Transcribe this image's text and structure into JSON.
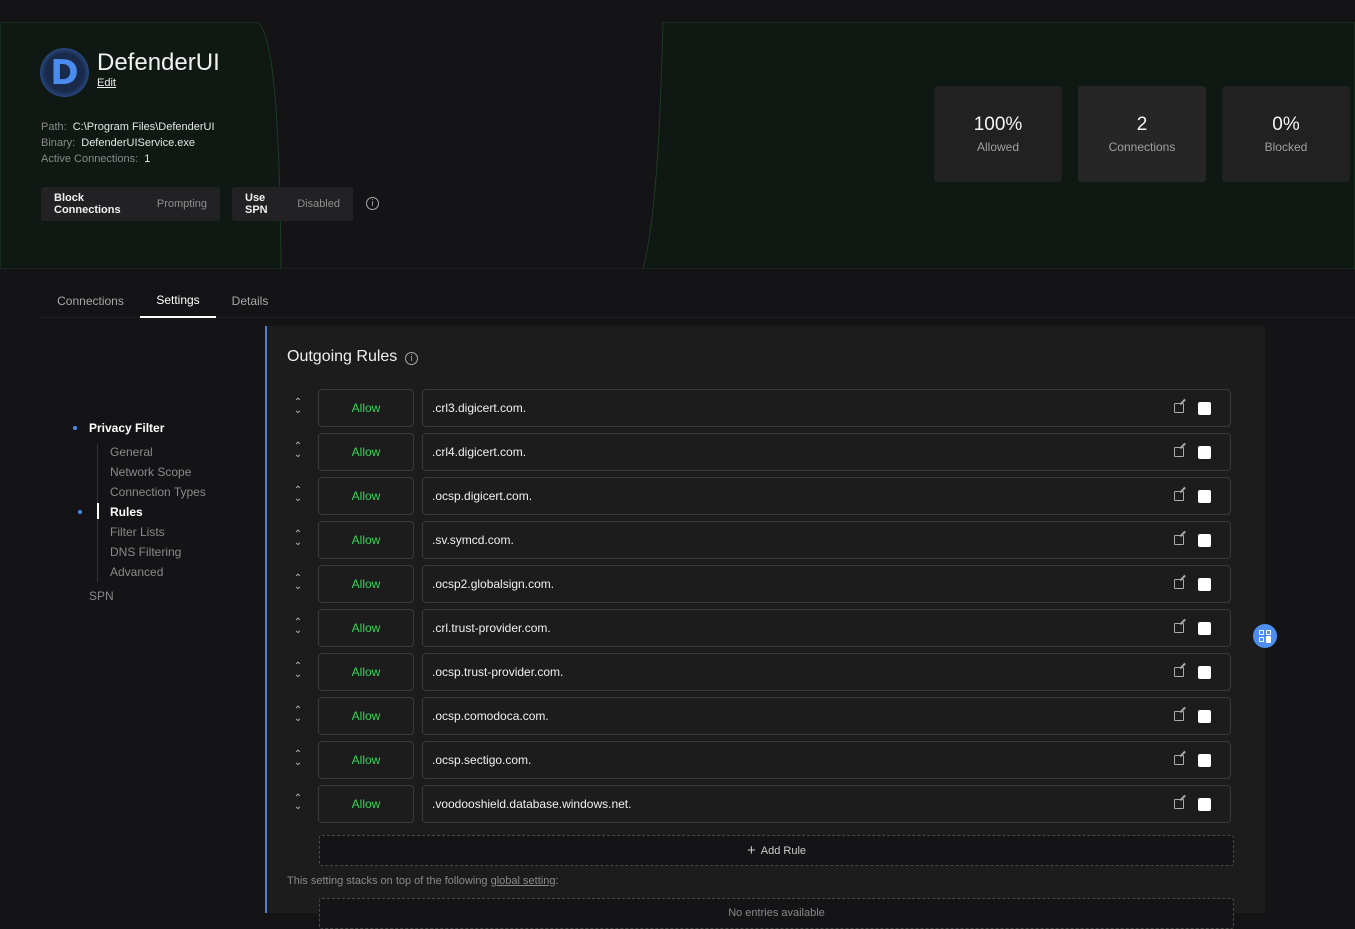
{
  "app": {
    "logo_letter": "D",
    "name": "DefenderUI",
    "edit_label": "Edit"
  },
  "meta": {
    "path_label": "Path:",
    "path": "C:\\Program Files\\DefenderUI",
    "binary_label": "Binary:",
    "binary": "DefenderUIService.exe",
    "active_label": "Active Connections:",
    "active": "1"
  },
  "toggles": [
    {
      "label": "Block Connections",
      "value": "Prompting"
    },
    {
      "label": "Use SPN",
      "value": "Disabled"
    }
  ],
  "stats": [
    {
      "value": "100%",
      "label": "Allowed"
    },
    {
      "value": "2",
      "label": "Connections"
    },
    {
      "value": "0%",
      "label": "Blocked"
    }
  ],
  "tabs": [
    "Connections",
    "Settings",
    "Details"
  ],
  "nav": {
    "section": "Privacy Filter",
    "items": [
      "General",
      "Network Scope",
      "Connection Types",
      "Rules",
      "Filter Lists",
      "DNS Filtering",
      "Advanced"
    ],
    "spn": "SPN"
  },
  "panel": {
    "title": "Outgoing Rules",
    "add_rule": "Add Rule",
    "note": "This setting stacks on top of the following ",
    "note_link": "global setting",
    "note_end": ":",
    "no_entries": "No entries available"
  },
  "rules": [
    {
      "action": "Allow",
      "domain": ".crl3.digicert.com."
    },
    {
      "action": "Allow",
      "domain": ".crl4.digicert.com."
    },
    {
      "action": "Allow",
      "domain": ".ocsp.digicert.com."
    },
    {
      "action": "Allow",
      "domain": ".sv.symcd.com."
    },
    {
      "action": "Allow",
      "domain": ".ocsp2.globalsign.com."
    },
    {
      "action": "Allow",
      "domain": ".crl.trust-provider.com."
    },
    {
      "action": "Allow",
      "domain": ".ocsp.trust-provider.com."
    },
    {
      "action": "Allow",
      "domain": ".ocsp.comodoca.com."
    },
    {
      "action": "Allow",
      "domain": ".ocsp.sectigo.com."
    },
    {
      "action": "Allow",
      "domain": ".voodooshield.database.windows.net."
    }
  ],
  "colors": {
    "accent": "#4a8cf0",
    "allow": "#38d35a"
  }
}
